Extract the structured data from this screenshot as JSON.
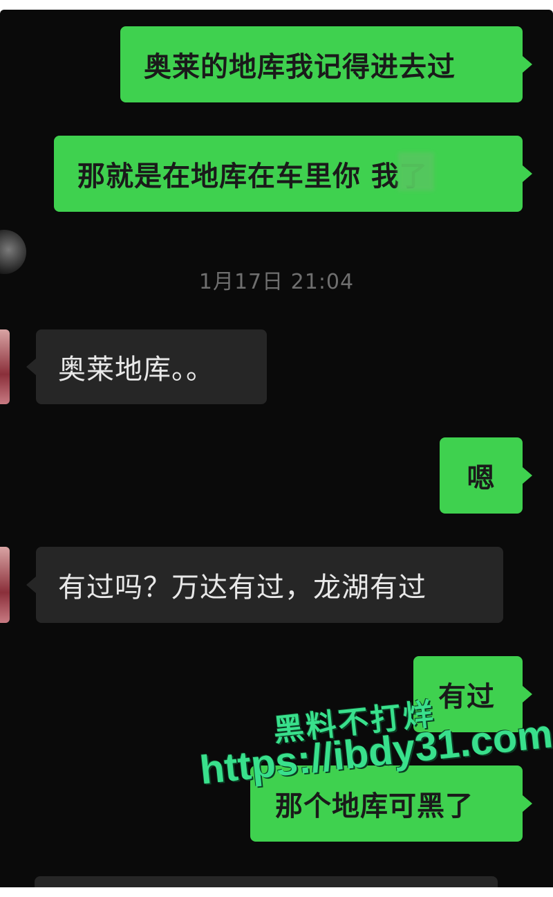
{
  "conversation": {
    "messages": [
      {
        "direction": "out",
        "text": "奥莱的地库我记得进去过"
      },
      {
        "direction": "out",
        "text": "那就是在地库在车里你    我了"
      },
      {
        "direction": "in",
        "text": "奥莱地库。。"
      },
      {
        "direction": "out",
        "text": "嗯"
      },
      {
        "direction": "in",
        "text": "有过吗？万达有过，龙湖有过"
      },
      {
        "direction": "out",
        "text": "有过"
      },
      {
        "direction": "out",
        "text": "那个地库可黑了"
      }
    ],
    "timestamp": "1月17日 21:04"
  },
  "watermark": {
    "line1": "黑料不打烊",
    "line2": "https://ibdy31.com"
  },
  "colors": {
    "background": "#0a0a0a",
    "outgoing_bubble": "#3fd14f",
    "incoming_bubble": "#262626",
    "watermark": "#39e08c"
  }
}
